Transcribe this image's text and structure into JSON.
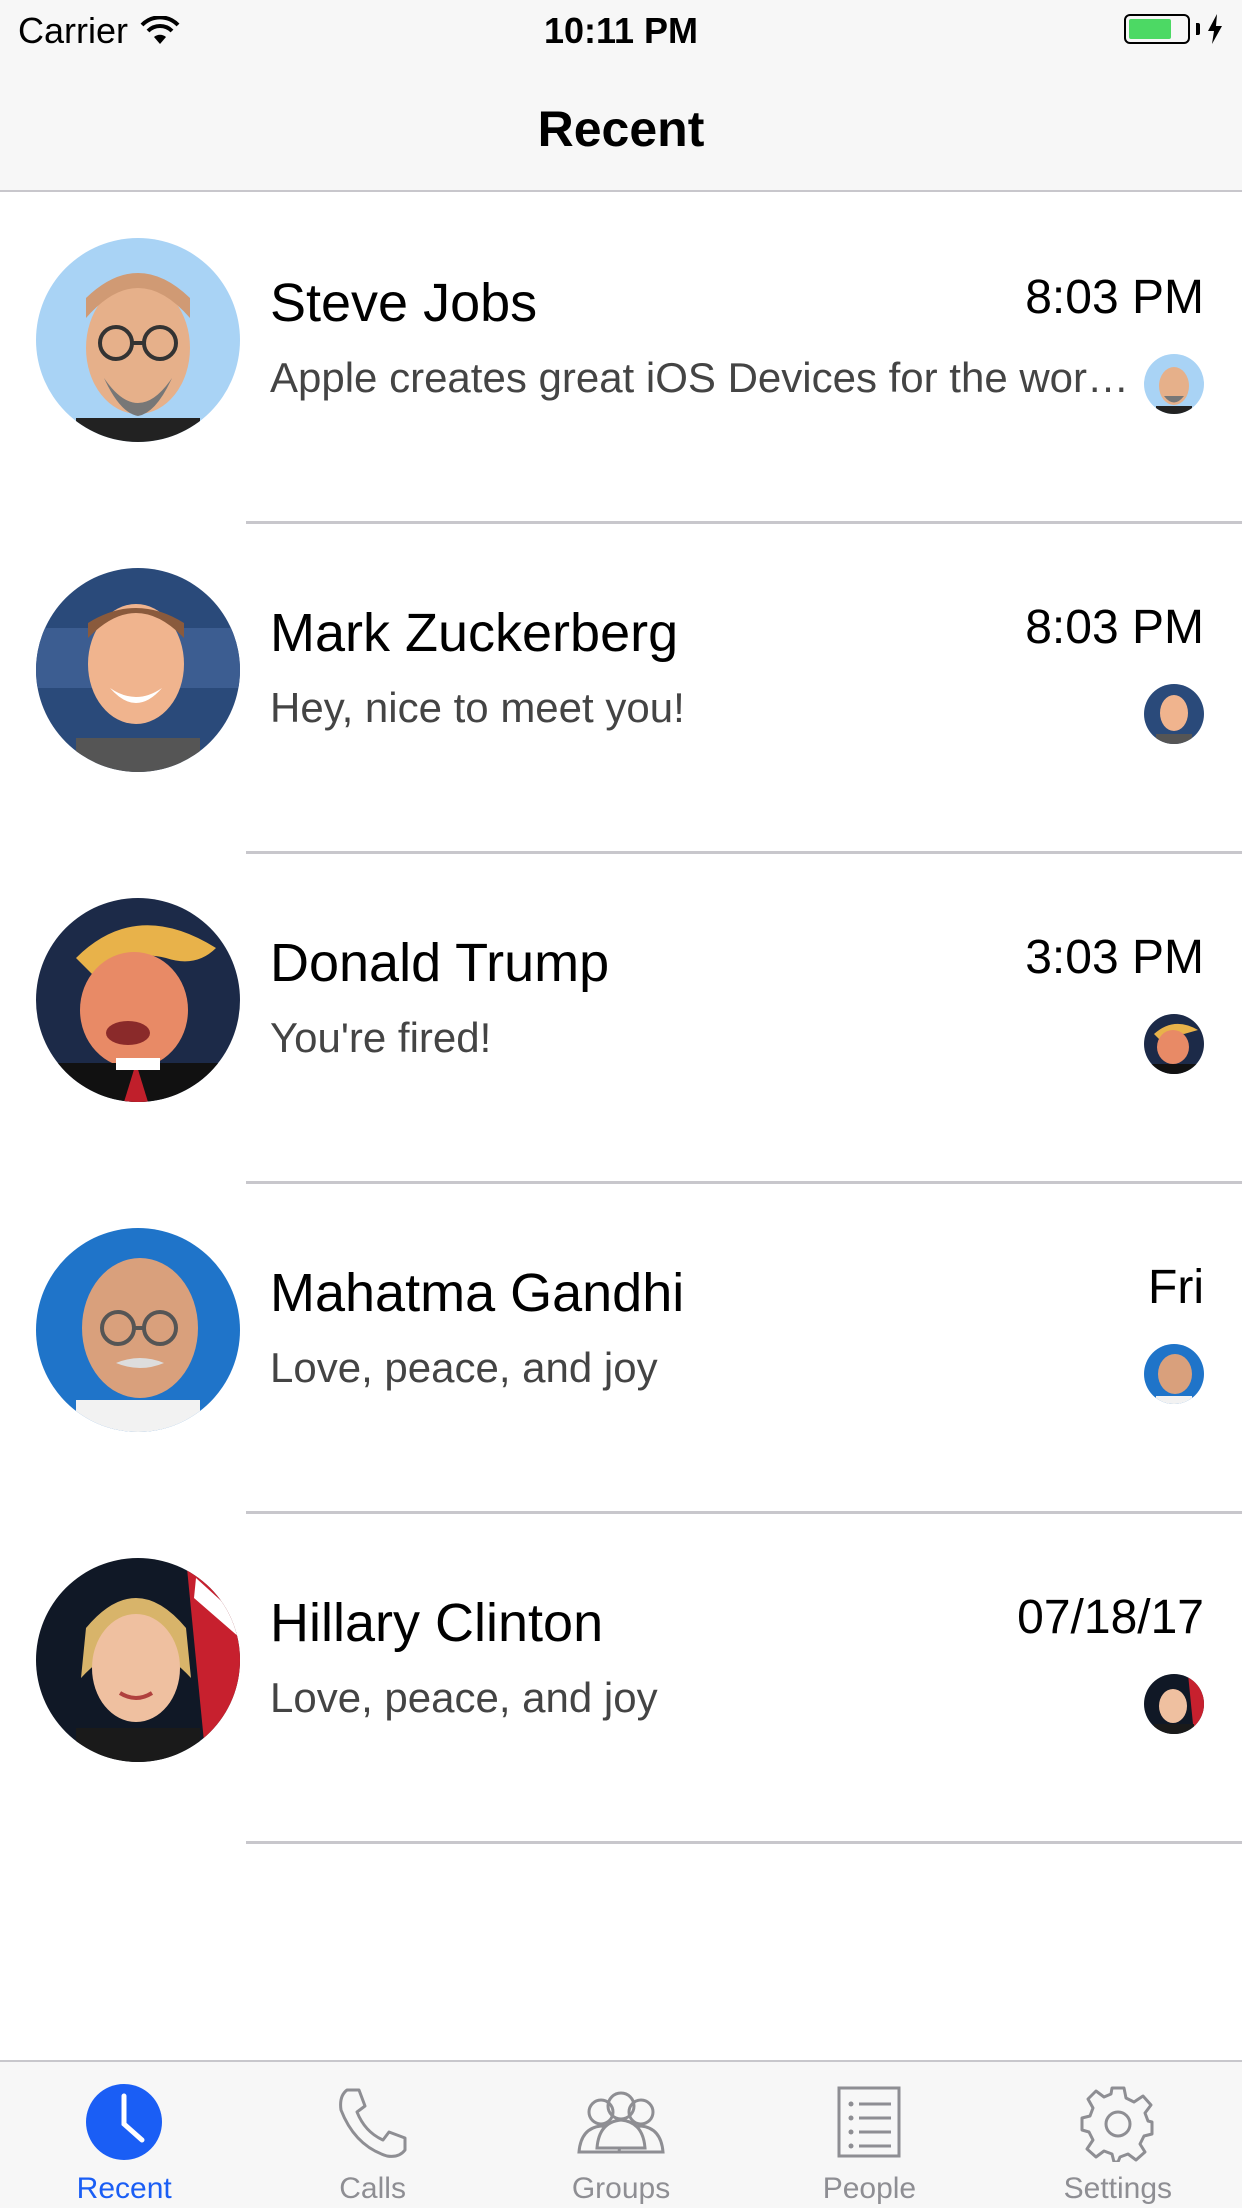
{
  "status_bar": {
    "carrier": "Carrier",
    "time": "10:11 PM",
    "battery_level": 0.75,
    "battery_color": "#4cd964"
  },
  "nav": {
    "title": "Recent"
  },
  "conversations": [
    {
      "name": "Steve Jobs",
      "time": "8:03 PM",
      "preview": "Apple creates great iOS Devices for the world and we are happy",
      "avatar": "steve-jobs-avatar"
    },
    {
      "name": "Mark Zuckerberg",
      "time": "8:03 PM",
      "preview": "Hey, nice to meet you!",
      "avatar": "mark-zuckerberg-avatar"
    },
    {
      "name": "Donald Trump",
      "time": "3:03 PM",
      "preview": "You're fired!",
      "avatar": "donald-trump-avatar"
    },
    {
      "name": "Mahatma Gandhi",
      "time": "Fri",
      "preview": "Love, peace, and joy",
      "avatar": "mahatma-gandhi-avatar"
    },
    {
      "name": "Hillary Clinton",
      "time": "07/18/17",
      "preview": "Love, peace, and joy",
      "avatar": "hillary-clinton-avatar"
    }
  ],
  "tabs": [
    {
      "label": "Recent",
      "icon": "clock-icon",
      "active": true
    },
    {
      "label": "Calls",
      "icon": "phone-icon",
      "active": false
    },
    {
      "label": "Groups",
      "icon": "groups-icon",
      "active": false
    },
    {
      "label": "People",
      "icon": "list-icon",
      "active": false
    },
    {
      "label": "Settings",
      "icon": "gear-icon",
      "active": false
    }
  ],
  "colors": {
    "accent": "#1a5ef5",
    "inactive": "#8e8e93",
    "separator": "#c8c7cc",
    "bar_background": "#f7f7f7"
  }
}
